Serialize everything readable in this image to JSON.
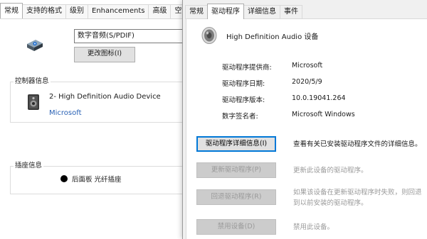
{
  "left_dialog": {
    "tabs": [
      "常规",
      "支持的格式",
      "级别",
      "Enhancements",
      "高级",
      "空"
    ],
    "device_name": "数字音频(S/PDIF)",
    "change_icon_button": "更改图标(I)",
    "controller_legend": "控制器信息",
    "controller_name": "2- High Definition Audio Device",
    "controller_vendor": "Microsoft",
    "jack_legend": "插座信息",
    "jack_label": "后面板 光纤插座"
  },
  "right_dialog": {
    "tabs": [
      "常规",
      "驱动程序",
      "详细信息",
      "事件"
    ],
    "active_tab": "驱动程序",
    "device_title": "High Definition Audio 设备",
    "info": [
      {
        "label": "驱动程序提供商:",
        "value": "Microsoft"
      },
      {
        "label": "驱动程序日期:",
        "value": "2020/5/9"
      },
      {
        "label": "驱动程序版本:",
        "value": "10.0.19041.264"
      },
      {
        "label": "数字签名者:",
        "value": "Microsoft Windows"
      }
    ],
    "actions": [
      {
        "button": "驱动程序详细信息(I)",
        "description": "查看有关已安装驱动程序文件的详细信息。",
        "enabled": true
      },
      {
        "button": "更新驱动程序(P)",
        "description": "更新此设备的驱动程序。",
        "enabled": false
      },
      {
        "button": "回退驱动程序(R)",
        "description": "如果该设备在更新驱动程序时失败，则回退到以前安装的驱动程序。",
        "enabled": false
      },
      {
        "button": "禁用设备(D)",
        "description": "禁用此设备。",
        "enabled": false
      }
    ]
  },
  "icons": {
    "device_icon": "spdif-port-icon",
    "controller_icon": "audio-device-icon",
    "jack_icon": "black-dot-icon",
    "speaker_icon": "speaker-icon"
  },
  "colors": {
    "link_blue": "#2a62b5",
    "focus_blue": "#0078d7",
    "disabled_text": "#9a9a9a"
  }
}
